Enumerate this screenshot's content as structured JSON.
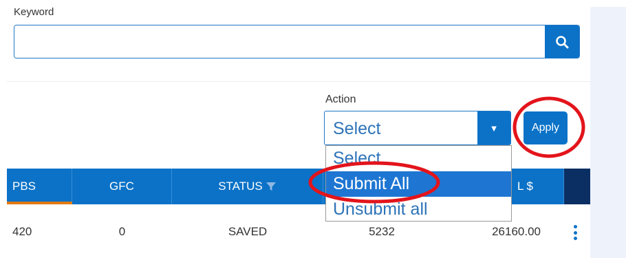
{
  "search": {
    "label": "Keyword",
    "value": "",
    "placeholder": ""
  },
  "icons": {
    "search": "search-icon",
    "dropdown": "triangle-down-icon",
    "filter": "funnel-icon",
    "menu": "vertical-ellipsis-icon"
  },
  "action": {
    "label": "Action",
    "selected": "Select",
    "arrow": "▼",
    "apply_label": "Apply",
    "options": [
      "Select",
      "Submit All",
      "Unsubmit all"
    ],
    "highlighted_option": "Submit All"
  },
  "table": {
    "headers": {
      "pbs": "PBS",
      "gfc": "GFC",
      "status": "STATUS",
      "col4": "",
      "total": "L $"
    },
    "rows": [
      {
        "pbs": "420",
        "gfc": "0",
        "status": "SAVED",
        "col4": "5232",
        "total": "26160.00"
      }
    ]
  },
  "colors": {
    "primary": "#0b72c7",
    "accent_orange": "#e07b14",
    "annotation_red": "#e3141b",
    "panel": "#eef3fb",
    "navy": "#0b2f63"
  }
}
